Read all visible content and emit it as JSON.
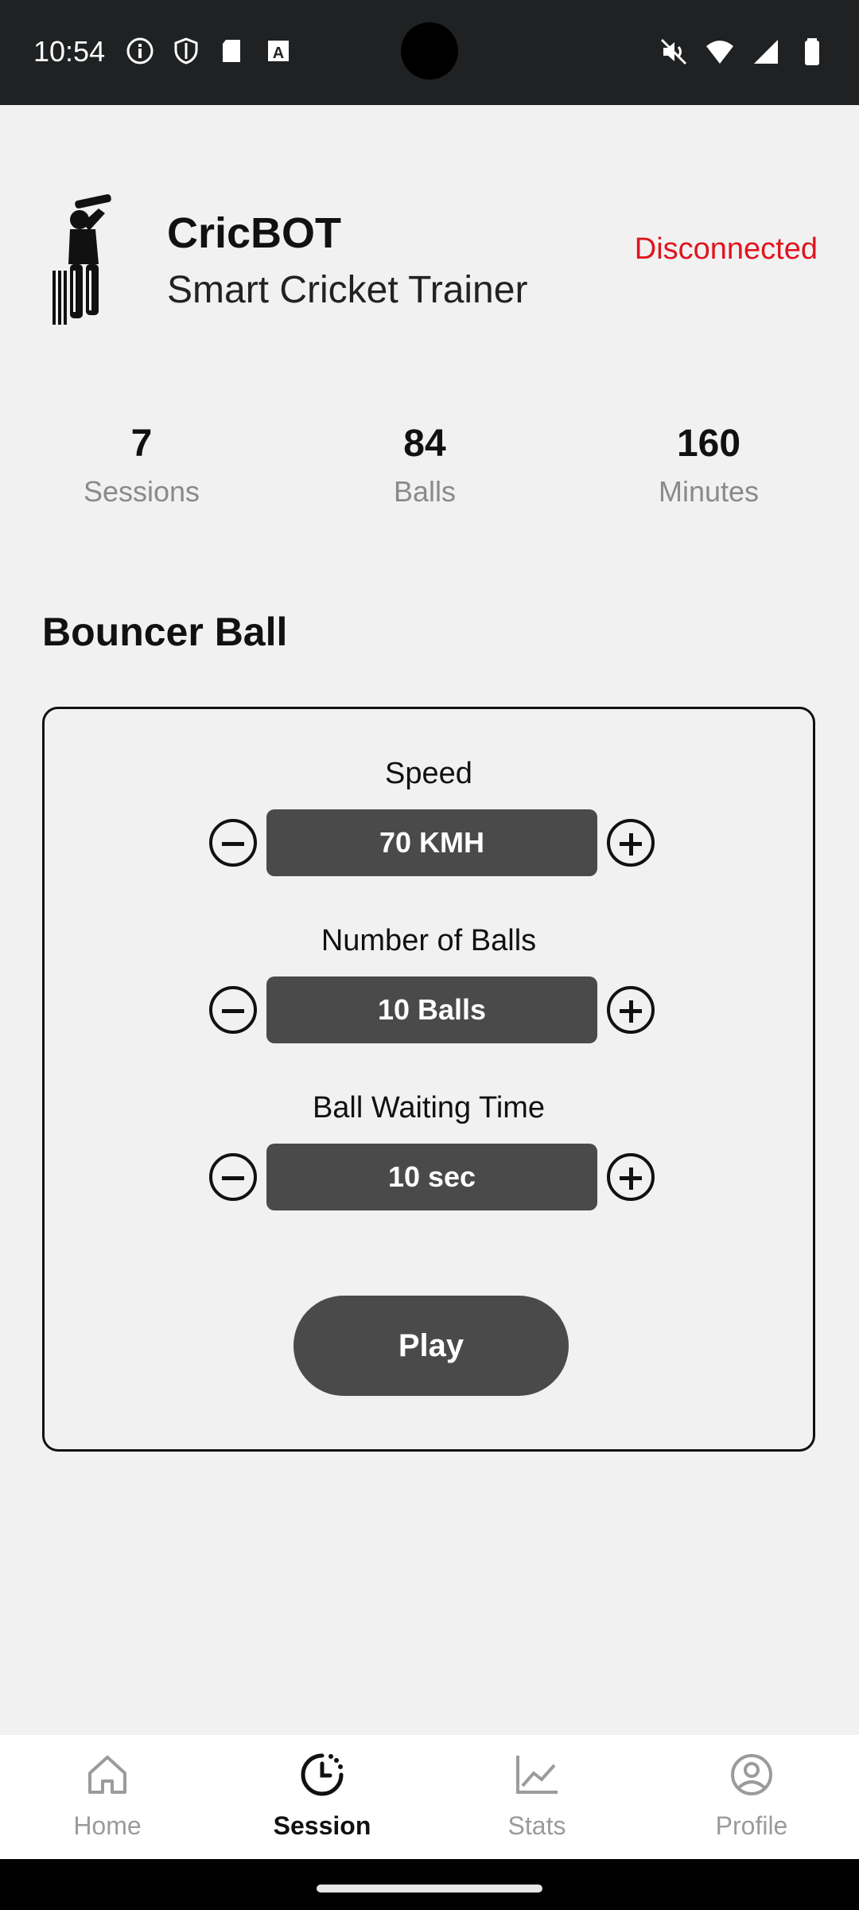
{
  "status_bar": {
    "time": "10:54",
    "left_icons": [
      "info-icon",
      "shield-icon",
      "sdcard-icon",
      "text-a-icon"
    ],
    "right_icons": [
      "mute-icon",
      "wifi-icon",
      "signal-icon",
      "battery-icon"
    ]
  },
  "header": {
    "logo": "cricket-batsman-icon",
    "title": "CricBOT",
    "subtitle": "Smart Cricket Trainer",
    "connection_status": "Disconnected",
    "connection_color": "#e0151f"
  },
  "stats": [
    {
      "value": "7",
      "label": "Sessions"
    },
    {
      "value": "84",
      "label": "Balls"
    },
    {
      "value": "160",
      "label": "Minutes"
    }
  ],
  "section_title": "Bouncer Ball",
  "controls": [
    {
      "label": "Speed",
      "value": "70 KMH"
    },
    {
      "label": "Number of Balls",
      "value": "10 Balls"
    },
    {
      "label": "Ball Waiting Time",
      "value": "10 sec"
    }
  ],
  "play_label": "Play",
  "bottom_nav": [
    {
      "label": "Home",
      "icon": "home-icon",
      "active": false
    },
    {
      "label": "Session",
      "icon": "clock-icon",
      "active": true
    },
    {
      "label": "Stats",
      "icon": "chart-icon",
      "active": false
    },
    {
      "label": "Profile",
      "icon": "profile-icon",
      "active": false
    }
  ]
}
